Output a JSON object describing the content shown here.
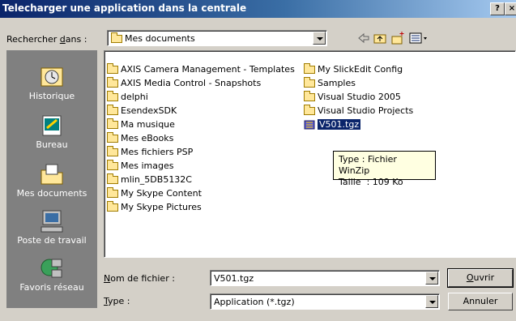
{
  "window": {
    "title": "Telecharger une application dans la centrale",
    "help_label": "?",
    "close_label": "×"
  },
  "lookin": {
    "label_pre": "Rechercher ",
    "label_key": "d",
    "label_post": "ans :",
    "value": "Mes documents"
  },
  "places": [
    {
      "label": "Historique",
      "icon": "history-icon"
    },
    {
      "label": "Bureau",
      "icon": "desktop-icon"
    },
    {
      "label": "Mes documents",
      "icon": "my-documents-icon"
    },
    {
      "label": "Poste de travail",
      "icon": "my-computer-icon"
    },
    {
      "label": "Favoris réseau",
      "icon": "network-places-icon"
    }
  ],
  "files": {
    "col1": [
      "AXIS Camera Management - Templates",
      "AXIS Media Control - Snapshots",
      "delphi",
      "EsendexSDK",
      "Ma musique",
      "Mes eBooks",
      "Mes fichiers PSP",
      "Mes images",
      "mlin_5DB5132C",
      "My Skype Content",
      "My Skype Pictures"
    ],
    "col2": [
      "My SlickEdit Config",
      "Samples",
      "Visual Studio 2005",
      "Visual Studio Projects",
      "V501.tgz"
    ],
    "selected": "V501.tgz"
  },
  "tooltip": {
    "line1": "Type : Fichier WinZip",
    "line2": "Taille  : 109 Ko"
  },
  "filename": {
    "label_key": "N",
    "label_post": "om de fichier :",
    "value": "V501.tgz"
  },
  "filetype": {
    "label_key": "T",
    "label_post": "ype :",
    "value": "Application (*.tgz)"
  },
  "buttons": {
    "open_key": "O",
    "open_post": "uvrir",
    "cancel": "Annuler"
  }
}
